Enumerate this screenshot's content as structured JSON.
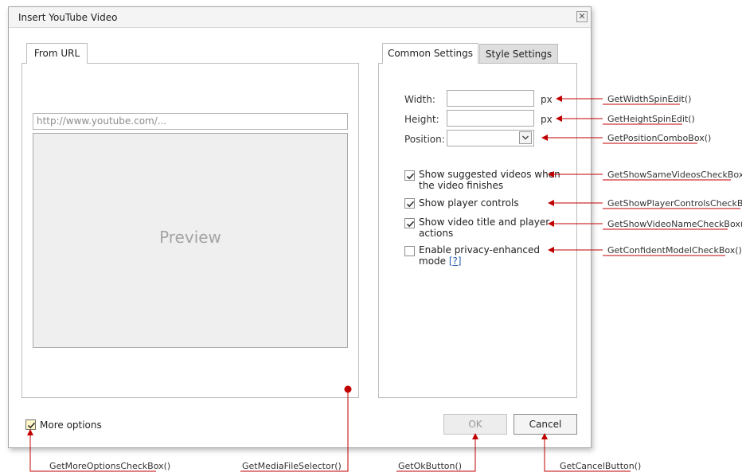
{
  "dialog": {
    "title": "Insert YouTube Video",
    "close_icon": "close-icon"
  },
  "left_tabs": [
    {
      "label": "From URL",
      "active": true
    }
  ],
  "url_input": {
    "placeholder": "http://www.youtube.com/..."
  },
  "preview": {
    "label": "Preview"
  },
  "right_tabs": [
    {
      "label": "Common Settings",
      "active": true
    },
    {
      "label": "Style Settings",
      "active": false
    }
  ],
  "settings": {
    "width_label": "Width:",
    "width_unit": "px",
    "height_label": "Height:",
    "height_unit": "px",
    "position_label": "Position:"
  },
  "checkboxes": {
    "suggested_line1": "Show suggested videos when",
    "suggested_line2": "the video finishes",
    "suggested_checked": true,
    "controls": "Show player controls",
    "controls_checked": true,
    "title_line1": "Show video title and player",
    "title_line2": "actions",
    "title_checked": true,
    "privacy_line1": "Enable privacy-enhanced",
    "privacy_line2": "mode",
    "privacy_help": "[?]",
    "privacy_checked": false
  },
  "footer": {
    "more_options": "More options",
    "more_options_checked": true,
    "ok": "OK",
    "cancel": "Cancel"
  },
  "callouts": {
    "width": "GetWidthSpinEdit()",
    "height": "GetHeightSpinEdit()",
    "position": "GetPositionComboBox()",
    "suggested": "GetShowSameVideosCheckBox()",
    "controls": "GetShowPlayerControlsCheckBox()",
    "title": "GetShowVideoNameCheckBox()",
    "privacy": "GetConfidentModelCheckBox()",
    "more_options": "GetMoreOptionsCheckBox()",
    "media_selector": "GetMediaFileSelector()",
    "ok": "GetOkButton()",
    "cancel": "GetCancelButton()"
  },
  "colors": {
    "callout_line": "#c00000",
    "checkbox_highlight": "#fff7c6"
  }
}
